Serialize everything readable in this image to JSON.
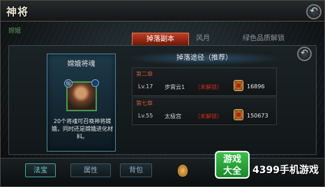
{
  "header": {
    "title": "神将",
    "subtitle": "嫦娥"
  },
  "tabs": [
    {
      "label": "掉落副本",
      "active": true
    },
    {
      "label": "风月",
      "active": false
    },
    {
      "label": "绿色品质解锁",
      "active": false
    }
  ],
  "card": {
    "title": "嫦娥将魂",
    "badge": "仙",
    "description": "20个将魂可召唤神将嫦娥，同时还是嫦娥进化材料。"
  },
  "routes": {
    "header": "掉落途径（推荐）",
    "items": [
      {
        "chapter": "第二章",
        "level": "Lv.17",
        "stage": "步霄云1",
        "status": "（未解锁）",
        "power": "16896"
      },
      {
        "chapter": "第七章",
        "level": "Lv.55",
        "stage": "太极宫",
        "status": "（未解锁）",
        "power": "150673"
      }
    ]
  },
  "bottom": {
    "magic_label": "法宝",
    "attr_label": "属性",
    "bag_label": "背包"
  },
  "watermark": {
    "logo_top": "游戏",
    "logo_bottom": "大全",
    "text": "4399手机游戏"
  },
  "icons": {
    "back": "back-arrow-icon",
    "power": "power-seal-icon",
    "drop": "drop-icon"
  },
  "colors": {
    "active_tab": "#c23b20",
    "locked_text": "#d42c1a",
    "chapter_text": "#c85536",
    "card_border": "#4e8aa4"
  }
}
